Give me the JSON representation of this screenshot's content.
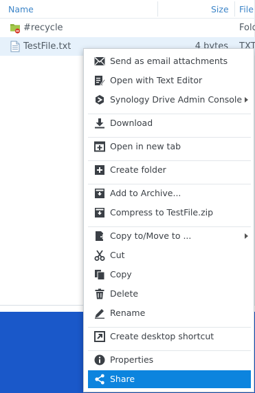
{
  "file_list": {
    "columns": {
      "name": "Name",
      "size": "Size",
      "file_type": "File"
    },
    "rows": [
      {
        "name": "#recycle",
        "size": "",
        "type": "Fold",
        "icon": "recycle-folder-icon"
      },
      {
        "name": "TestFile.txt",
        "size": "4 bytes",
        "type": "TXT",
        "icon": "text-file-icon"
      }
    ]
  },
  "context_menu": {
    "items": [
      {
        "label": "Send as email attachments",
        "icon": "email-icon"
      },
      {
        "label": "Open with Text Editor",
        "icon": "text-editor-icon"
      },
      {
        "label": "Synology Drive Admin Console",
        "icon": "synology-drive-icon",
        "submenu": true
      },
      {
        "label": "Download",
        "icon": "download-icon"
      },
      {
        "label": "Open in new tab",
        "icon": "new-tab-icon"
      },
      {
        "label": "Create folder",
        "icon": "create-folder-icon"
      },
      {
        "label": "Add to Archive...",
        "icon": "archive-icon"
      },
      {
        "label": "Compress to TestFile.zip",
        "icon": "compress-icon"
      },
      {
        "label": "Copy to/Move to ...",
        "icon": "copy-move-icon",
        "submenu": true
      },
      {
        "label": "Cut",
        "icon": "scissors-icon"
      },
      {
        "label": "Copy",
        "icon": "copy-icon"
      },
      {
        "label": "Delete",
        "icon": "trash-icon"
      },
      {
        "label": "Rename",
        "icon": "pencil-icon"
      },
      {
        "label": "Create desktop shortcut",
        "icon": "shortcut-icon"
      },
      {
        "label": "Properties",
        "icon": "info-icon"
      },
      {
        "label": "Share",
        "icon": "share-icon",
        "highlighted": true
      }
    ]
  },
  "colors": {
    "accent": "#0c84de",
    "header_text": "#3d85c8",
    "selected_row": "#e6f1fb",
    "desktop": "#1a58c9"
  }
}
